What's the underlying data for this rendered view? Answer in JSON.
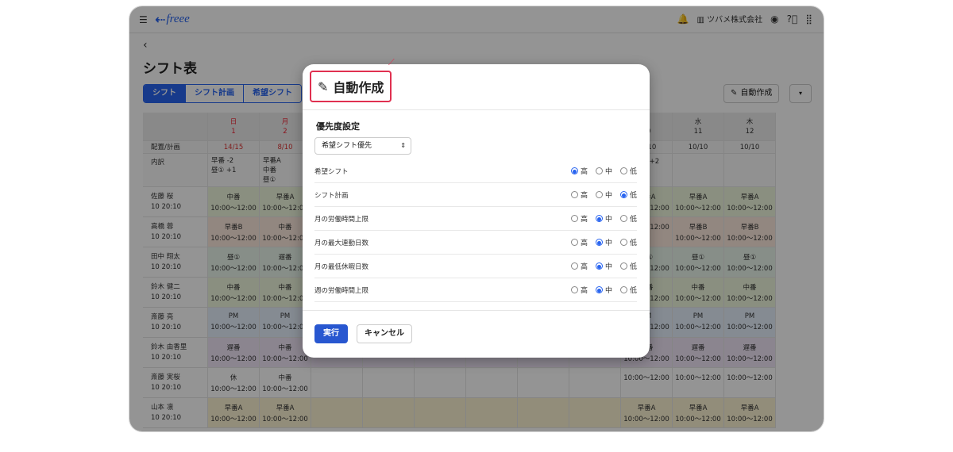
{
  "topbar": {
    "menu_icon": "hamburger-icon",
    "logo_text": "freee",
    "company": "ツバメ株式会社"
  },
  "page": {
    "back_icon": "chevron-left-icon",
    "title": "シフト表",
    "auto_button": "自動作成"
  },
  "tabs": [
    "シフト",
    "シフト計画",
    "希望シフト"
  ],
  "grid": {
    "row_header_label": "配置/計画",
    "breakdown_label": "内訳",
    "days_left": [
      {
        "dow": "日",
        "date": "1",
        "count": "14/15"
      },
      {
        "dow": "月",
        "date": "2",
        "count": "8/10"
      }
    ],
    "days_right": [
      {
        "dow": "火",
        "date": "10",
        "count": "12/10"
      },
      {
        "dow": "水",
        "date": "11",
        "count": "10/10"
      },
      {
        "dow": "木",
        "date": "12",
        "count": "10/10"
      }
    ],
    "breakdown_left": [
      "早番 -2",
      "昼① +1",
      "早番A",
      "中番",
      "昼①"
    ],
    "breakdown_right": [
      "遅番 +2"
    ],
    "employees": [
      {
        "name": "佐藤 桜",
        "meta": "10  20:10",
        "c1": "中番",
        "c2": "早番A",
        "r1": "早番A",
        "r2": "早番A",
        "r3": "早番A"
      },
      {
        "name": "高橋 蓉",
        "meta": "10  20:10",
        "c1": "早番B",
        "c2": "中番",
        "r1": "",
        "r2": "早番B",
        "r3": "早番B"
      },
      {
        "name": "田中 翔太",
        "meta": "10  20:10",
        "c1": "昼①",
        "c2": "遅番",
        "r1": "昼①",
        "r2": "昼①",
        "r3": "昼①"
      },
      {
        "name": "鈴木 健二",
        "meta": "10  20:10",
        "c1": "中番",
        "c2": "中番",
        "r1": "中番",
        "r2": "中番",
        "r3": "中番"
      },
      {
        "name": "斎藤 亮",
        "meta": "10  20:10",
        "c1": "PM",
        "c2": "PM",
        "r1": "PM",
        "r2": "PM",
        "r3": "PM"
      },
      {
        "name": "鈴木 由香里",
        "meta": "10  20:10",
        "c1": "遅番",
        "c2": "中番",
        "r1": "遅番",
        "r2": "遅番",
        "r3": "遅番"
      },
      {
        "name": "斎藤 実桜",
        "meta": "10  20:10",
        "c1": "休",
        "c2": "中番",
        "r1": "",
        "r2": "",
        "r3": ""
      },
      {
        "name": "山本 凛",
        "meta": "10  20:10",
        "c1": "早番A",
        "c2": "早番A",
        "r1": "早番A",
        "r2": "早番A",
        "r3": "早番A"
      }
    ],
    "time": "10:00～12:00"
  },
  "modal": {
    "title": "自動作成",
    "priority_label": "優先度設定",
    "priority_value": "希望シフト優先",
    "levels": [
      "高",
      "中",
      "低"
    ],
    "rules": [
      {
        "name": "希望シフト",
        "selected": 0
      },
      {
        "name": "シフト計画",
        "selected": 2
      },
      {
        "name": "月の労働時間上限",
        "selected": 1
      },
      {
        "name": "月の最大連勤日数",
        "selected": 1
      },
      {
        "name": "月の最低休暇日数",
        "selected": 1
      },
      {
        "name": "週の労働時間上限",
        "selected": 1
      }
    ],
    "execute": "実行",
    "cancel": "キャンセル"
  }
}
